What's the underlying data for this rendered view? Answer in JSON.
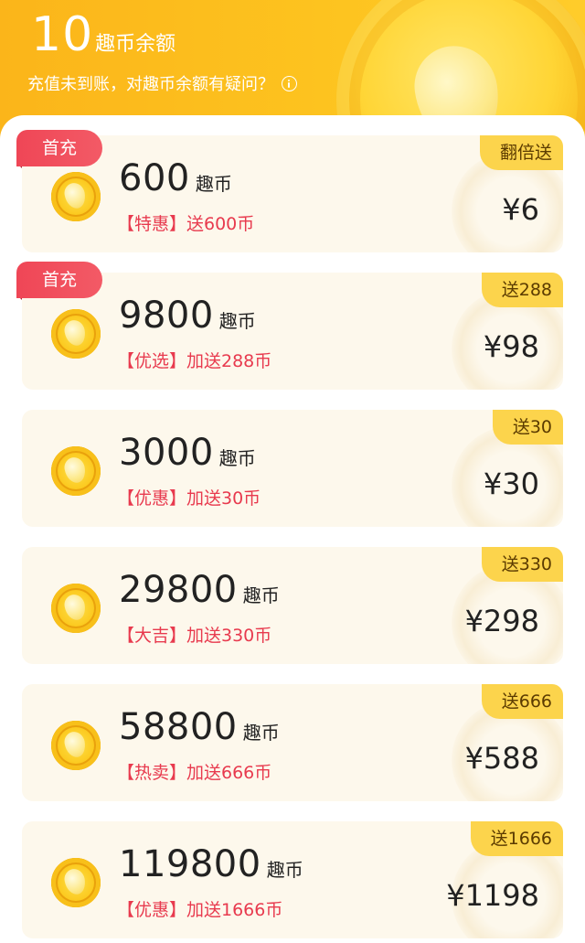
{
  "header": {
    "balance_value": "10",
    "balance_unit": "趣币余额",
    "hint_text": "充值未到账，对趣币余额有疑问？",
    "hint_icon": "info-icon"
  },
  "packages": [
    {
      "amount": "600",
      "unit": "趣币",
      "promo": "【特惠】送600币",
      "price": "¥6",
      "badge": "翻倍送",
      "first_tag": "首充"
    },
    {
      "amount": "9800",
      "unit": "趣币",
      "promo": "【优选】加送288币",
      "price": "¥98",
      "badge": "送288",
      "first_tag": "首充"
    },
    {
      "amount": "3000",
      "unit": "趣币",
      "promo": "【优惠】加送30币",
      "price": "¥30",
      "badge": "送30",
      "first_tag": ""
    },
    {
      "amount": "29800",
      "unit": "趣币",
      "promo": "【大吉】加送330币",
      "price": "¥298",
      "badge": "送330",
      "first_tag": ""
    },
    {
      "amount": "58800",
      "unit": "趣币",
      "promo": "【热卖】加送666币",
      "price": "¥588",
      "badge": "送666",
      "first_tag": ""
    },
    {
      "amount": "119800",
      "unit": "趣币",
      "promo": "【优惠】加送1666币",
      "price": "¥1198",
      "badge": "送1666",
      "first_tag": ""
    }
  ],
  "colors": {
    "header_bg": "#fcc01f",
    "card_bg": "#fdf8ec",
    "promo_text": "#e83a4e",
    "badge_bg": "#fcd44c",
    "first_tag_bg": "#ef4656"
  }
}
